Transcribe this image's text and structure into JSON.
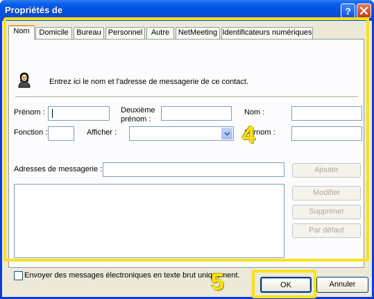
{
  "window": {
    "title": "Propriétés de",
    "help_label": "?",
    "close_label": "×"
  },
  "tabs": [
    {
      "label": "Nom",
      "active": true
    },
    {
      "label": "Domicile"
    },
    {
      "label": "Bureau"
    },
    {
      "label": "Personnel"
    },
    {
      "label": "Autre"
    },
    {
      "label": "NetMeeting"
    },
    {
      "label": "Identificateurs numériques"
    }
  ],
  "panel": {
    "intro_text": "Entrez ici le nom et l'adresse de messagerie de ce contact.",
    "icon": "contact-person-icon",
    "fields": {
      "prenom_label": "Prénom :",
      "prenom_value": "",
      "deuxieme_prenom_label_1": "Deuxième",
      "deuxieme_prenom_label_2": "prénom :",
      "deuxieme_prenom_value": "",
      "nom_label": "Nom :",
      "nom_value": "",
      "fonction_label": "Fonction :",
      "fonction_value": "",
      "afficher_label": "Afficher :",
      "afficher_value": "",
      "surnom_label": "Surnom :",
      "surnom_value": ""
    },
    "email": {
      "label": "Adresses de messagerie :",
      "value": ""
    },
    "buttons": {
      "ajouter": "Ajouter",
      "modifier": "Modifier",
      "supprimer": "Supprimer",
      "par_defaut": "Par défaut"
    },
    "checkbox_label": "Envoyer des messages électroniques en texte brut uniquement.",
    "checkbox_checked": false
  },
  "footer": {
    "ok": "OK",
    "annuler": "Annuler"
  },
  "annotations": {
    "marker_4": "4",
    "marker_5": "5",
    "highlight_color": "#f7e21b"
  }
}
